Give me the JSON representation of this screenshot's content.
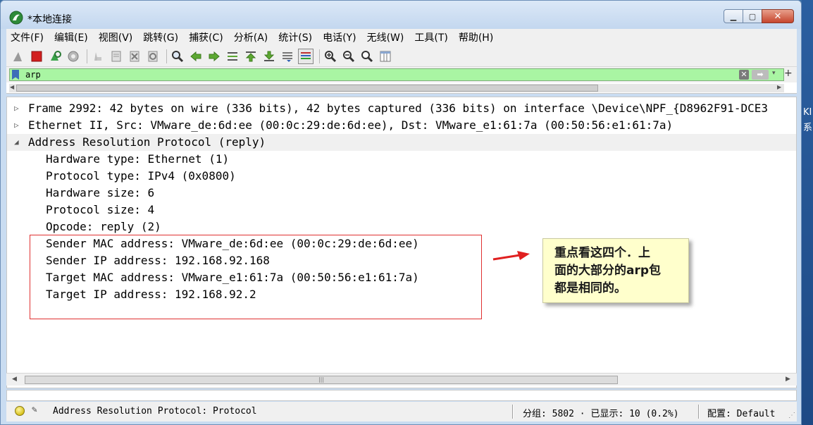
{
  "window": {
    "title": "*本地连接"
  },
  "desktop": {
    "edge_text_top": "KI",
    "edge_text_bottom": "系"
  },
  "menubar": {
    "items": [
      "文件(F)",
      "编辑(E)",
      "视图(V)",
      "跳转(G)",
      "捕获(C)",
      "分析(A)",
      "统计(S)",
      "电话(Y)",
      "无线(W)",
      "工具(T)",
      "帮助(H)"
    ]
  },
  "toolbar": {
    "icons": [
      "shark-fin-start-icon",
      "stop-capture-icon",
      "restart-capture-icon",
      "capture-options-icon",
      "open-file-icon",
      "save-file-icon",
      "close-file-icon",
      "reload-file-icon",
      "find-packet-icon",
      "go-back-icon",
      "go-forward-icon",
      "go-to-packet-icon",
      "go-first-icon",
      "go-last-icon",
      "auto-scroll-icon",
      "colorize-icon",
      "zoom-in-icon",
      "zoom-out-icon",
      "zoom-normal-icon",
      "resize-columns-icon"
    ]
  },
  "filter": {
    "value": "arp",
    "clear_glyph": "✕",
    "apply_glyph": "➡",
    "dropdown_glyph": "▾",
    "add_glyph": "+"
  },
  "details": {
    "rows": [
      {
        "expander": "▷",
        "text": "Frame 2992: 42 bytes on wire (336 bits), 42 bytes captured (336 bits) on interface \\Device\\NPF_{D8962F91-DCE3",
        "level": 0
      },
      {
        "expander": "▷",
        "text": "Ethernet II, Src: VMware_de:6d:ee (00:0c:29:de:6d:ee), Dst: VMware_e1:61:7a (00:50:56:e1:61:7a)",
        "level": 0
      },
      {
        "expander": "◢",
        "text": "Address Resolution Protocol (reply)",
        "level": 0,
        "selected": true
      },
      {
        "expander": "",
        "text": "Hardware type: Ethernet (1)",
        "level": 1
      },
      {
        "expander": "",
        "text": "Protocol type: IPv4 (0x0800)",
        "level": 1
      },
      {
        "expander": "",
        "text": "Hardware size: 6",
        "level": 1
      },
      {
        "expander": "",
        "text": "Protocol size: 4",
        "level": 1
      },
      {
        "expander": "",
        "text": "Opcode: reply (2)",
        "level": 1
      },
      {
        "expander": "",
        "text": "Sender MAC address: VMware_de:6d:ee (00:0c:29:de:6d:ee)",
        "level": 1
      },
      {
        "expander": "",
        "text": "Sender IP address: 192.168.92.168",
        "level": 1
      },
      {
        "expander": "",
        "text": "Target MAC address: VMware_e1:61:7a (00:50:56:e1:61:7a)",
        "level": 1
      },
      {
        "expander": "",
        "text": "Target IP address: 192.168.92.2",
        "level": 1
      }
    ]
  },
  "annotation": {
    "lines": [
      "重点看这四个．上",
      "面的大部分的arp包",
      "都是相同的。"
    ]
  },
  "statusbar": {
    "text": "Address Resolution Protocol: Protocol",
    "packets": "分组: 5802 · 已显示: 10 (0.2%)",
    "profile": "配置: Default"
  },
  "colors": {
    "filter_ok": "#a9f5a3",
    "highlight_border": "#e03030",
    "note_bg": "#ffffcc"
  }
}
